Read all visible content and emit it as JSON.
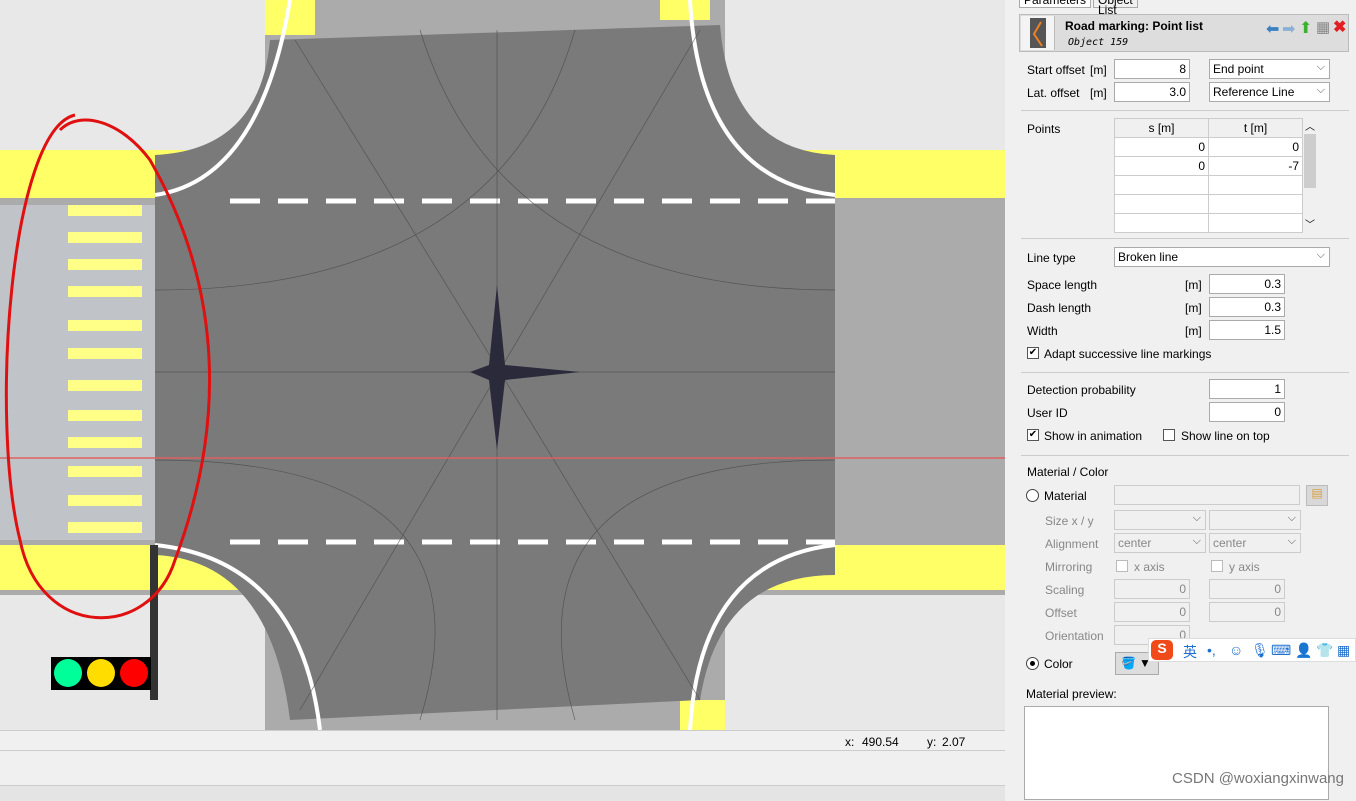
{
  "viewport": {
    "status": {
      "x_label": "x:",
      "x_value": "490.54",
      "y_label": "y:",
      "y_value": "2.07"
    }
  },
  "panel": {
    "tabs": [
      "Parameters",
      "Object List"
    ],
    "header": {
      "title": "Road marking: Point list",
      "subtitle": "Object 159",
      "icons": [
        "arrow-left-icon",
        "arrow-right-icon",
        "arrow-up-icon",
        "grid-icon",
        "close-icon"
      ]
    },
    "start_offset": {
      "label": "Start offset",
      "unit": "[m]",
      "value": "8",
      "mode": "End point"
    },
    "lat_offset": {
      "label": "Lat. offset",
      "unit": "[m]",
      "value": "3.0",
      "reference": "Reference Line"
    },
    "points": {
      "label": "Points",
      "columns": [
        "s [m]",
        "t [m]"
      ],
      "rows": [
        [
          "0",
          "0"
        ],
        [
          "0",
          "-7"
        ],
        [
          "",
          ""
        ],
        [
          "",
          ""
        ],
        [
          "",
          ""
        ]
      ]
    },
    "line_type": {
      "label": "Line type",
      "value": "Broken line"
    },
    "space_length": {
      "label": "Space length",
      "unit": "[m]",
      "value": "0.3"
    },
    "dash_length": {
      "label": "Dash length",
      "unit": "[m]",
      "value": "0.3"
    },
    "width": {
      "label": "Width",
      "unit": "[m]",
      "value": "1.5"
    },
    "adapt": {
      "label": "Adapt successive line markings",
      "checked": true
    },
    "detection_probability": {
      "label": "Detection probability",
      "value": "1"
    },
    "user_id": {
      "label": "User ID",
      "value": "0"
    },
    "show_in_animation": {
      "label": "Show in animation",
      "checked": true
    },
    "show_line_on_top": {
      "label": "Show line on top",
      "checked": false
    },
    "material_color": {
      "section": "Material / Color",
      "material_label": "Material",
      "material_value": "",
      "size_label": "Size x / y",
      "alignment_label": "Alignment",
      "alignment_x": "center",
      "alignment_y": "center",
      "mirroring_label": "Mirroring",
      "x_axis": "x axis",
      "y_axis": "y axis",
      "scaling_label": "Scaling",
      "scaling_x": "0",
      "scaling_y": "0",
      "offset_label": "Offset",
      "offset_x": "0",
      "offset_y": "0",
      "orientation_label": "Orientation",
      "orientation": "0",
      "color_label": "Color",
      "selected": "Color"
    },
    "material_preview": "Material preview:"
  },
  "ime": {
    "lang": "英"
  },
  "watermark": "CSDN @woxiangxinwang",
  "colors": {
    "road": "#8c8c8c",
    "sidewalk": "#ffff66",
    "annotation": "#e01010",
    "traffic_light": [
      "#00ff99",
      "#ffdd00",
      "#ff0000"
    ]
  }
}
